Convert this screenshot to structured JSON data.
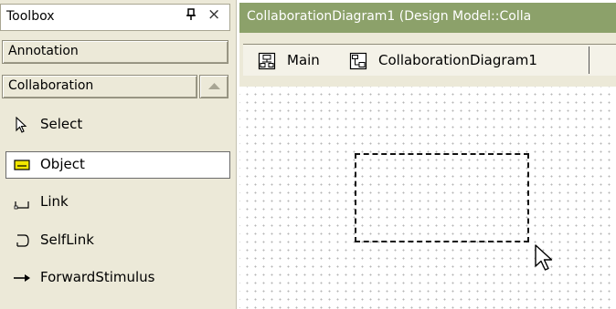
{
  "toolbox": {
    "title": "Toolbox",
    "pin_glyph": "Ԅ",
    "close_glyph": "×",
    "sections": {
      "annotation": "Annotation",
      "collaboration": "Collaboration"
    },
    "items": [
      {
        "label": "Select",
        "icon": "pointer-icon",
        "selected": false
      },
      {
        "label": "Object",
        "icon": "object-icon",
        "selected": true
      },
      {
        "label": "Link",
        "icon": "link-icon",
        "selected": false
      },
      {
        "label": "SelfLink",
        "icon": "selflink-icon",
        "selected": false
      },
      {
        "label": "ForwardStimulus",
        "icon": "forward-arrow-icon",
        "selected": false
      }
    ]
  },
  "document": {
    "title": "CollaborationDiagram1 (Design Model::Colla",
    "tabs": [
      {
        "label": "Main",
        "icon": "diagram-icon"
      },
      {
        "label": "CollaborationDiagram1",
        "icon": "collaboration-diagram-icon"
      }
    ]
  },
  "colors": {
    "title_bar": "#8ca16a",
    "panel_bg": "#ece9d8",
    "object_fill": "#f2e600"
  }
}
